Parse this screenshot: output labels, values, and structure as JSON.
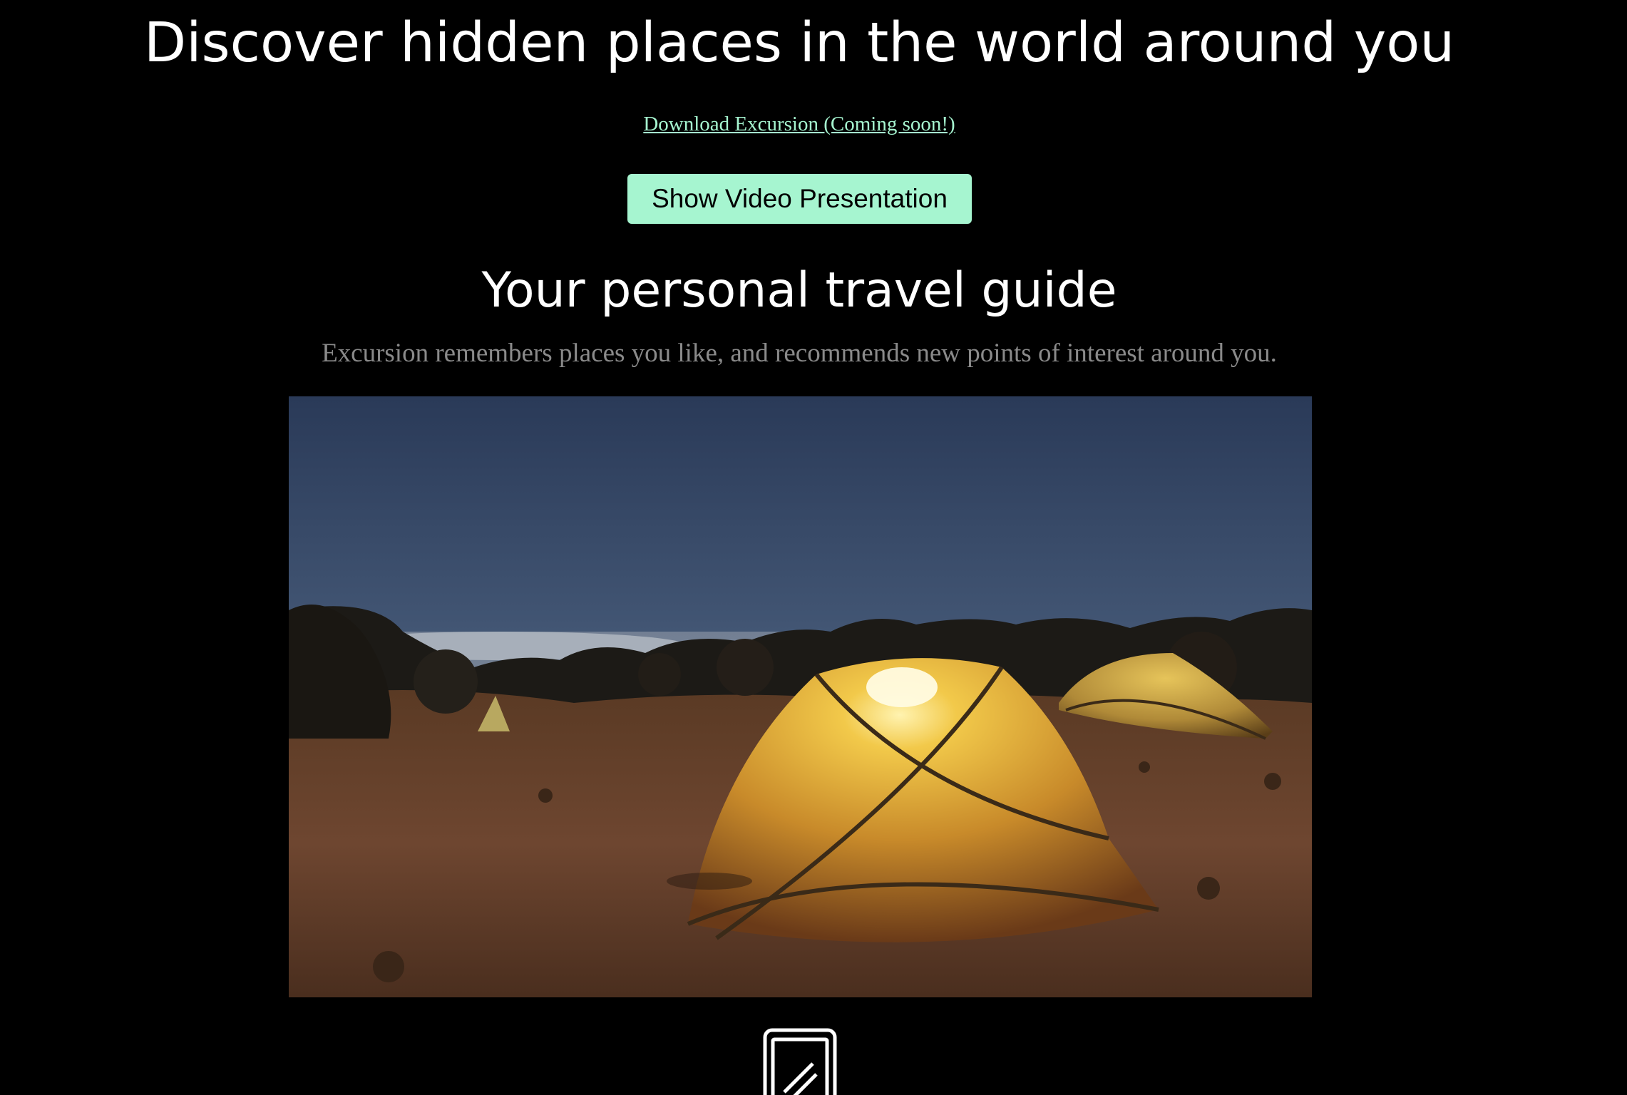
{
  "hero": {
    "title": "Discover hidden places in the world around you",
    "download_link": "Download Excursion (Coming soon!)",
    "video_button": "Show Video Presentation"
  },
  "feature": {
    "title": "Your personal travel guide",
    "subtitle": "Excursion remembers places you like, and recommends new points of interest around you."
  },
  "icons": {
    "feature_icon": "phone-icon"
  },
  "colors": {
    "background": "#000000",
    "accent": "#a6f5d0",
    "subtitle": "#8a8a8a"
  }
}
